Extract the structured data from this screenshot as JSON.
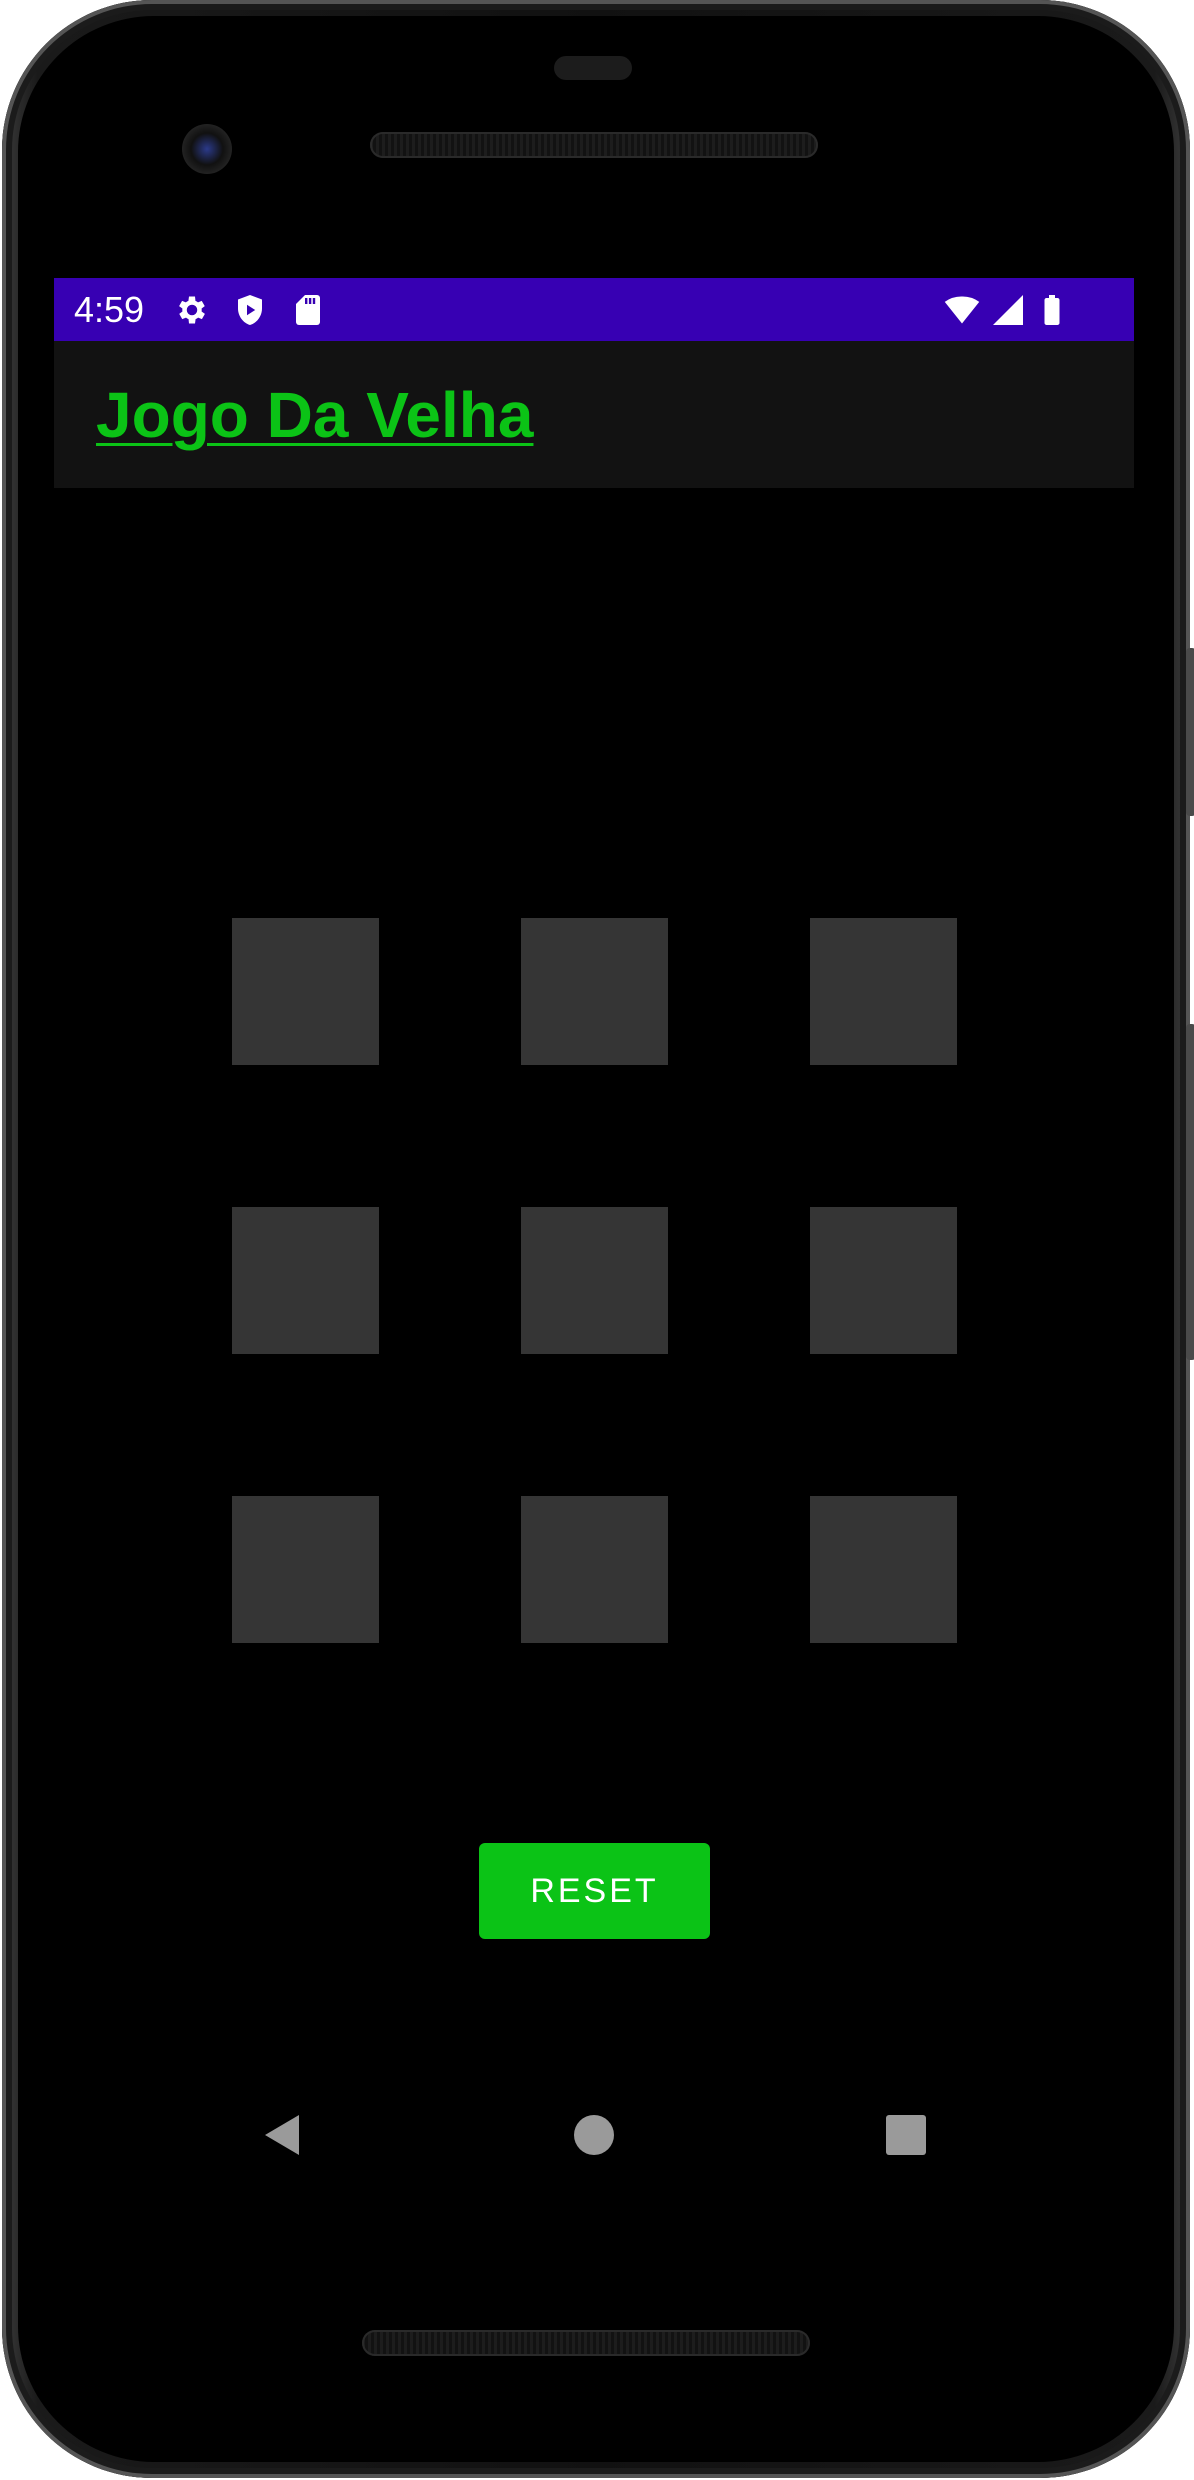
{
  "status_bar": {
    "time": "4:59",
    "left_icons": [
      "gear-icon",
      "shield-icon",
      "sd-card-icon"
    ],
    "right_icons": [
      "wifi-icon",
      "signal-icon",
      "battery-icon"
    ],
    "color": "#3700b3"
  },
  "app_bar": {
    "title": "Jogo Da Velha",
    "title_color": "#0bc316",
    "background": "#121212"
  },
  "board": {
    "cells": [
      "",
      "",
      "",
      "",
      "",
      "",
      "",
      "",
      ""
    ],
    "cell_color": "#353535"
  },
  "reset_button": {
    "label": "RESET",
    "color": "#0bc316"
  },
  "nav_bar": {
    "icons": [
      "back-icon",
      "home-icon",
      "recents-icon"
    ]
  }
}
